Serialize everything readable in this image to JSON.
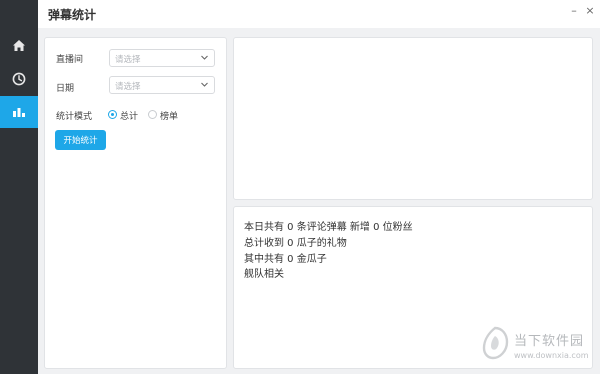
{
  "window": {
    "title": "弹幕统计",
    "minimize": "–",
    "close": "×"
  },
  "sidebar": {
    "items": [
      {
        "icon": "home-icon"
      },
      {
        "icon": "clock-icon"
      },
      {
        "icon": "bar-chart-icon",
        "active": true
      }
    ]
  },
  "form": {
    "streamer_label": "直播间",
    "streamer_placeholder": "请选择",
    "date_label": "日期",
    "date_placeholder": "请选择",
    "mode_label": "统计模式",
    "mode_options": [
      {
        "label": "总计",
        "checked": true
      },
      {
        "label": "榜单",
        "checked": false
      }
    ],
    "start_button": "开始统计"
  },
  "stats": {
    "lines": [
      "本日共有 0 条评论弹幕 新增 0 位粉丝",
      "总计收到 0 瓜子的礼物",
      "其中共有 0 金瓜子",
      "舰队相关"
    ]
  },
  "watermark": {
    "brand": "当下软件园",
    "url": "www.downxia.com"
  },
  "colors": {
    "accent": "#1ea7e8",
    "sidebar": "#2f3337"
  }
}
